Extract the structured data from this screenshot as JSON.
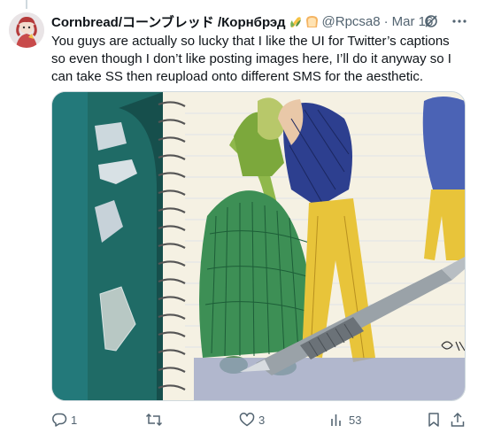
{
  "tweet": {
    "display_name": "Cornbread/コーンブレッド /Корнбрэд",
    "handle": "@Rpcsa8",
    "separator": "·",
    "date": "Mar 16",
    "text": "You guys are actually so lucky that I like the UI for Twitter’s captions so even though I don’t like posting images here, I’ll do it anyway so I can take SS then reupload onto different SMS for the aesthetic.",
    "media_icons": [
      "corn-emoji",
      "bread-emoji"
    ]
  },
  "actions": {
    "reply_count": "1",
    "retweet_count": "",
    "like_count": "3",
    "views_count": "53"
  },
  "colors": {
    "text": "#0f1419",
    "secondary": "#536471",
    "border": "#cfd9de"
  },
  "icons": [
    "grok-icon",
    "more-icon",
    "reply-icon",
    "retweet-icon",
    "like-icon",
    "views-icon",
    "bookmark-icon",
    "share-icon"
  ]
}
